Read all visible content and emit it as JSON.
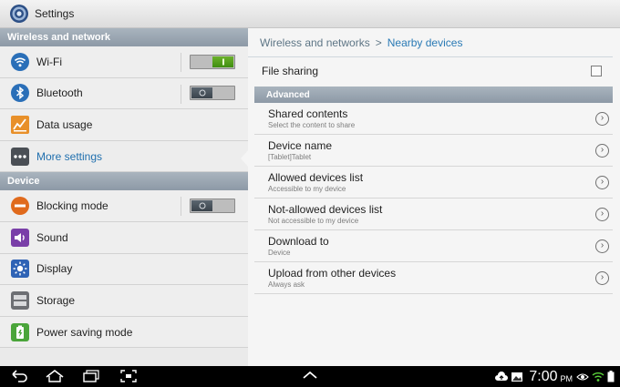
{
  "app": {
    "title": "Settings"
  },
  "left": {
    "sections": [
      {
        "header": "Wireless and network",
        "items": [
          {
            "label": "Wi-Fi",
            "icon": "wifi-icon",
            "toggle": "on"
          },
          {
            "label": "Bluetooth",
            "icon": "bluetooth-icon",
            "toggle": "off"
          },
          {
            "label": "Data usage",
            "icon": "data-usage-icon"
          },
          {
            "label": "More settings",
            "icon": "more-settings-icon",
            "active": true
          }
        ]
      },
      {
        "header": "Device",
        "items": [
          {
            "label": "Blocking mode",
            "icon": "blocking-mode-icon",
            "toggle": "off"
          },
          {
            "label": "Sound",
            "icon": "sound-icon"
          },
          {
            "label": "Display",
            "icon": "display-icon"
          },
          {
            "label": "Storage",
            "icon": "storage-icon"
          },
          {
            "label": "Power saving mode",
            "icon": "power-saving-icon"
          }
        ]
      }
    ]
  },
  "right": {
    "breadcrumb": {
      "parent": "Wireless and networks",
      "separator": ">",
      "current": "Nearby devices"
    },
    "file_sharing": {
      "label": "File sharing",
      "checked": false
    },
    "advanced_header": "Advanced",
    "items": [
      {
        "title": "Shared contents",
        "subtitle": "Select the content to share"
      },
      {
        "title": "Device name",
        "subtitle": "[Tablet]Tablet"
      },
      {
        "title": "Allowed devices list",
        "subtitle": "Accessible to my device"
      },
      {
        "title": "Not-allowed devices list",
        "subtitle": "Not accessible to my device"
      },
      {
        "title": "Download to",
        "subtitle": "Device"
      },
      {
        "title": "Upload from other devices",
        "subtitle": "Always ask"
      }
    ]
  },
  "statusbar": {
    "time": "7:00",
    "ampm": "PM"
  },
  "colors": {
    "accent": "#1f6fae",
    "header": "#98a4b0",
    "toggle_on": "#4e9d1a"
  }
}
